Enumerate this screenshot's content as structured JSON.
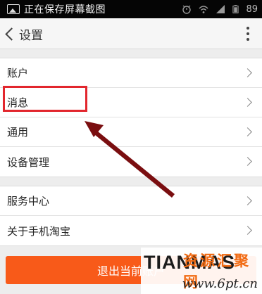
{
  "status_bar": {
    "text": "正在保存屏幕截图",
    "battery": "89"
  },
  "header": {
    "title": "设置"
  },
  "settings": {
    "group1": [
      {
        "label": "账户"
      },
      {
        "label": "消息"
      },
      {
        "label": "通用"
      },
      {
        "label": "设备管理"
      }
    ],
    "group2": [
      {
        "label": "服务中心"
      },
      {
        "label": "关于手机淘宝"
      }
    ]
  },
  "logout": {
    "label": "退出当前账户"
  },
  "watermark": {
    "brand": "TIANMAS",
    "cn_text": "资源汇聚网",
    "url": "www.6pt.cn"
  },
  "colors": {
    "accent_orange": "#f85a19",
    "highlight_red": "#e2262d",
    "arrow_dark_red": "#7a0e10"
  }
}
